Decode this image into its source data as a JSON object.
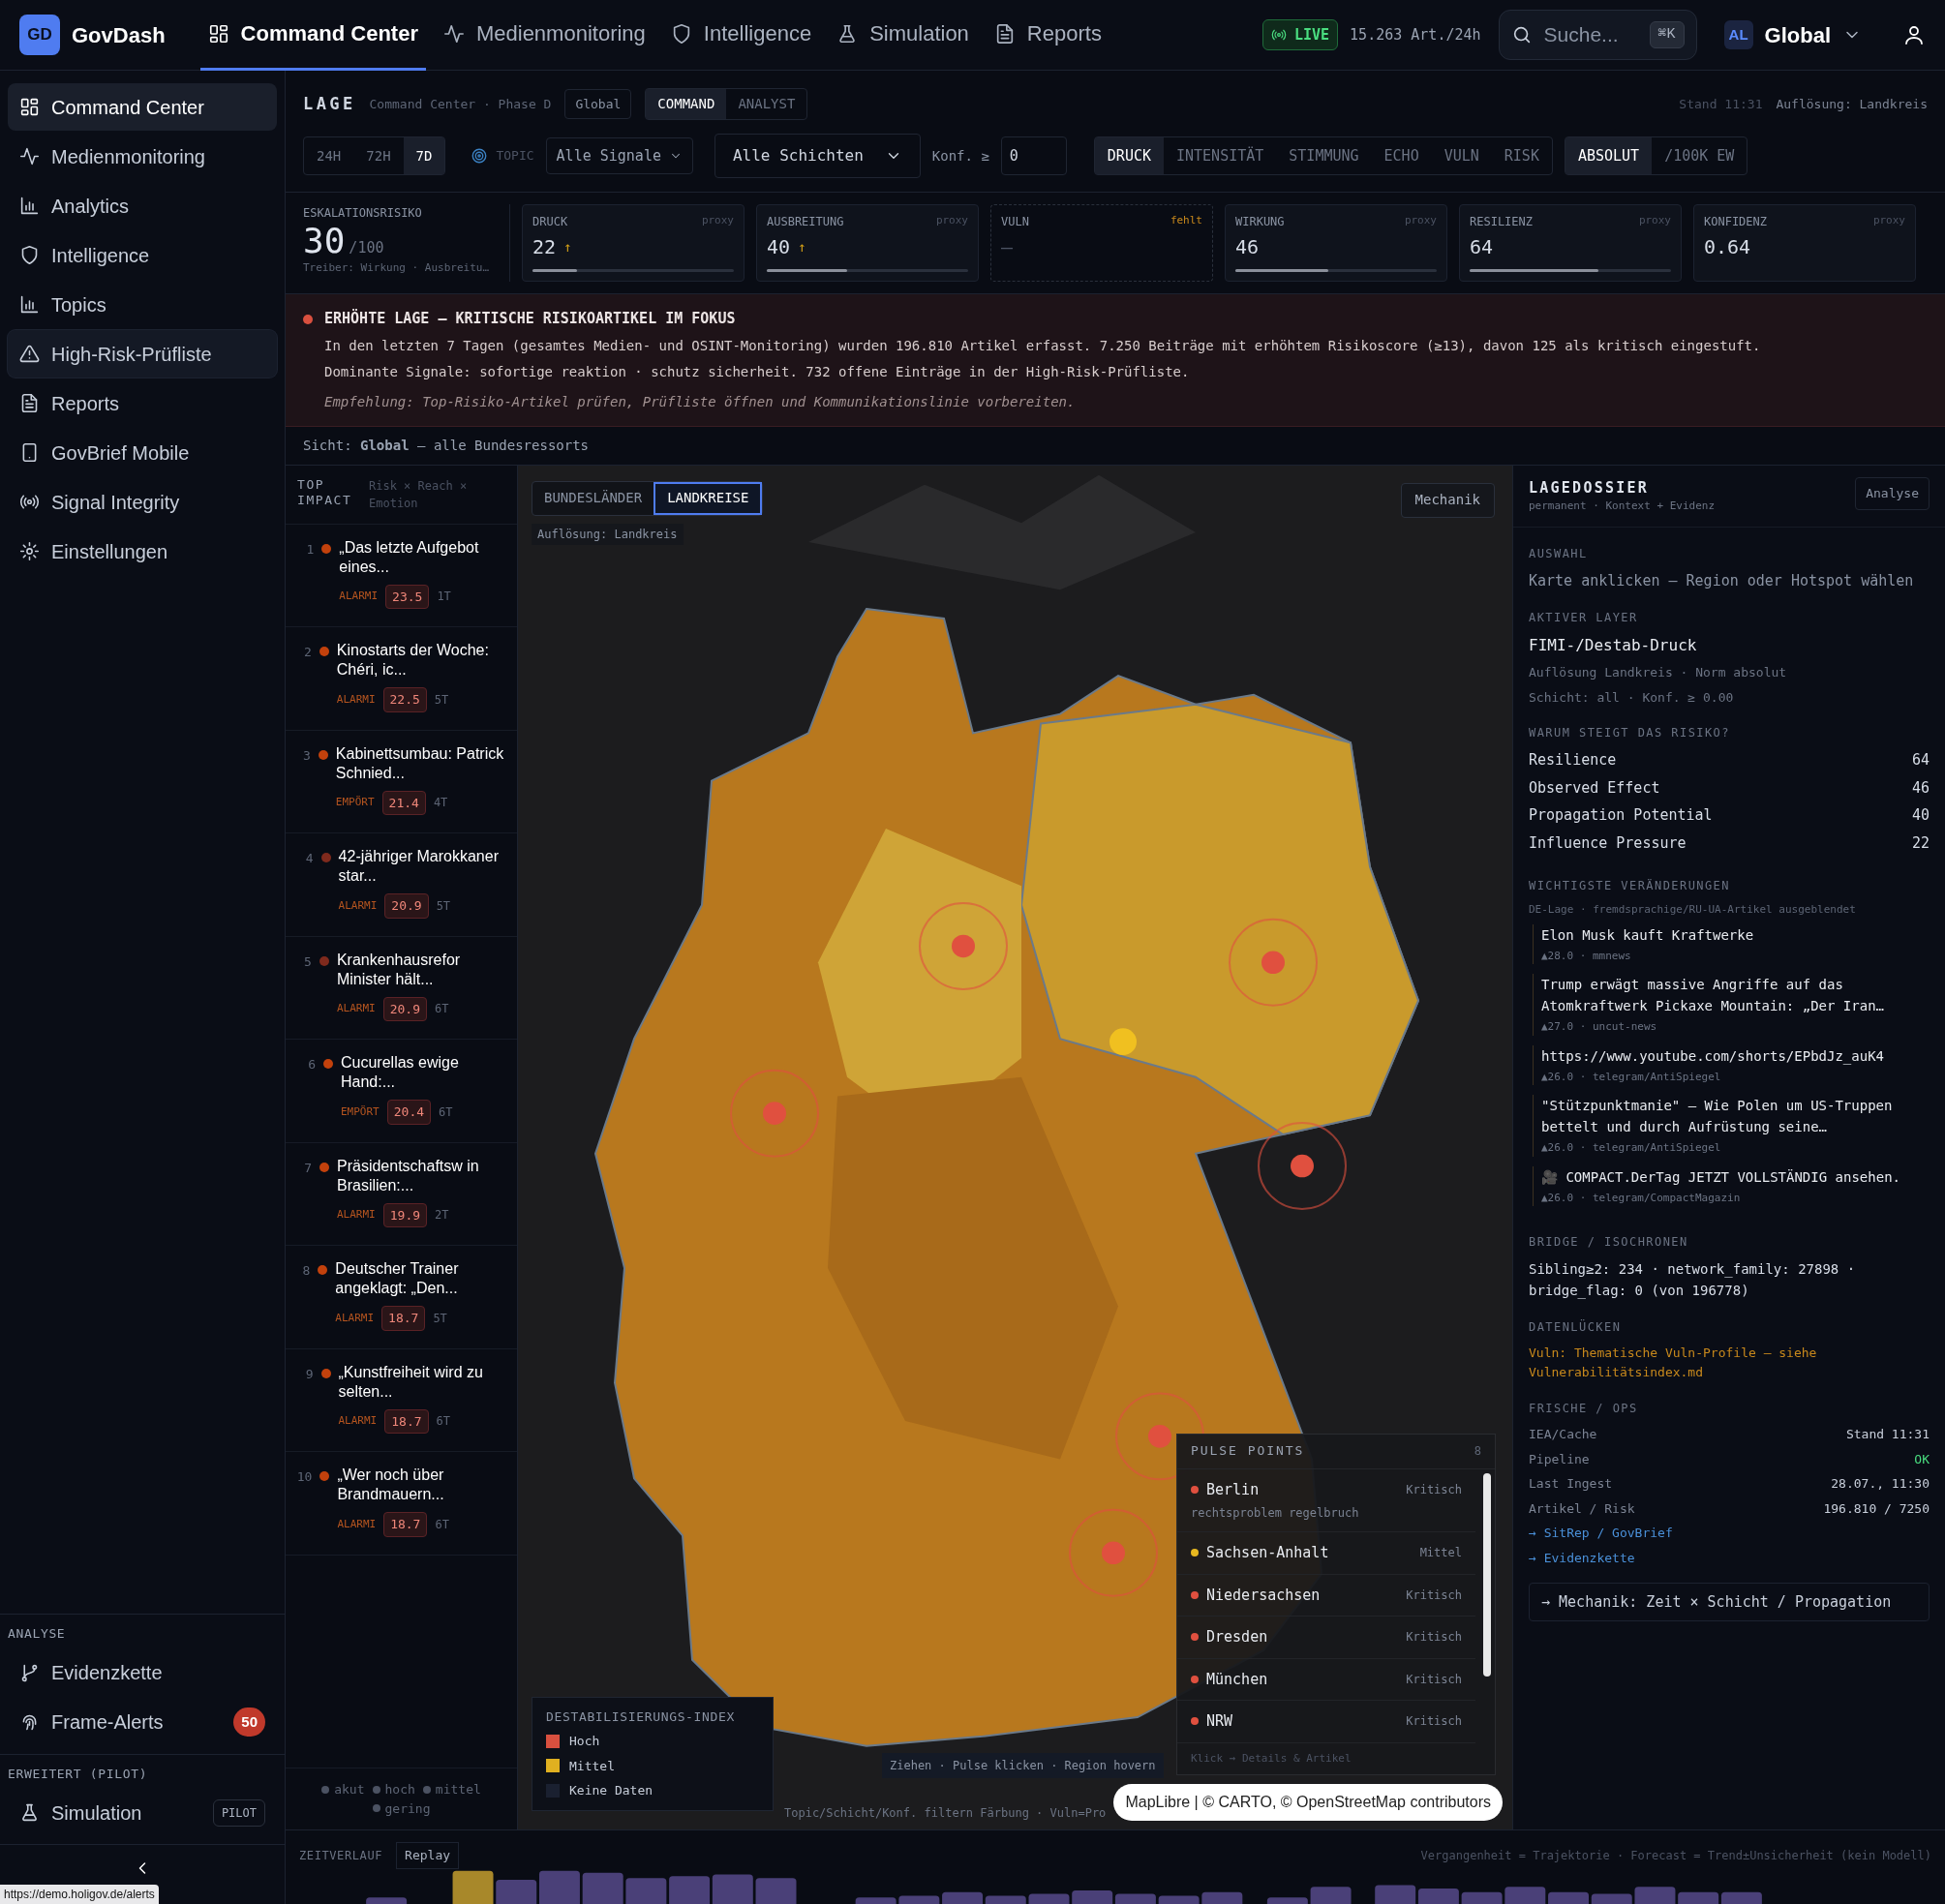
{
  "app": {
    "logo": "GD",
    "name": "GovDash"
  },
  "top_nav": [
    {
      "label": "Command Center",
      "kind": "grid",
      "selected": true
    },
    {
      "label": "Medienmonitoring",
      "kind": "pulse",
      "selected": false
    },
    {
      "label": "Intelligence",
      "kind": "shield",
      "selected": false
    },
    {
      "label": "Simulation",
      "kind": "flask",
      "selected": false
    },
    {
      "label": "Reports",
      "kind": "doc",
      "selected": false
    }
  ],
  "live": {
    "label": "LIVE",
    "rate": "15.263 Art./24h"
  },
  "search": {
    "placeholder": "Suche...",
    "shortcut": "⌘K"
  },
  "scope": {
    "badge": "AL",
    "label": "Global"
  },
  "sidebar": {
    "items": [
      {
        "label": "Command Center",
        "kind": "grid",
        "selected": true,
        "hovered": false
      },
      {
        "label": "Medienmonitoring",
        "kind": "pulse",
        "selected": false,
        "hovered": false
      },
      {
        "label": "Analytics",
        "kind": "bars",
        "selected": false,
        "hovered": false
      },
      {
        "label": "Intelligence",
        "kind": "shield",
        "selected": false,
        "hovered": false
      },
      {
        "label": "Topics",
        "kind": "bars",
        "selected": false,
        "hovered": false
      },
      {
        "label": "High-Risk-Prüfliste",
        "kind": "warning",
        "selected": false,
        "hovered": true
      },
      {
        "label": "Reports",
        "kind": "doc",
        "selected": false,
        "hovered": false
      },
      {
        "label": "GovBrief Mobile",
        "kind": "phone",
        "selected": false,
        "hovered": false
      },
      {
        "label": "Signal Integrity",
        "kind": "signal",
        "selected": false,
        "hovered": false
      },
      {
        "label": "Einstellungen",
        "kind": "gear",
        "selected": false,
        "hovered": false
      }
    ],
    "sections": [
      {
        "title": "ANALYSE",
        "items": [
          {
            "label": "Evidenzkette",
            "kind": "branch"
          },
          {
            "label": "Frame-Alerts",
            "kind": "fingerprint",
            "badge": "50"
          }
        ]
      },
      {
        "title": "ERWEITERT (PILOT)",
        "items": [
          {
            "label": "Simulation",
            "kind": "flask",
            "tag": "PILOT"
          }
        ]
      }
    ]
  },
  "status_url": "https://demo.holigov.de/alerts",
  "lage": {
    "title": "LAGE",
    "subtitle": "Command Center · Phase D",
    "scope": "Global",
    "modes": [
      {
        "label": "COMMAND",
        "selected": true
      },
      {
        "label": "ANALYST",
        "selected": false
      }
    ],
    "stand": "Stand 11:31",
    "resolution": "Auflösung: Landkreis",
    "ranges": [
      {
        "label": "24H",
        "selected": false
      },
      {
        "label": "72H",
        "selected": false
      },
      {
        "label": "7D",
        "selected": true
      }
    ],
    "topic_label": "TOPIC",
    "topic_select": "Alle Signale",
    "layer_select": "Alle Schichten",
    "conf_label": "Konf. ≥",
    "conf_value": "0",
    "metrics": [
      {
        "label": "DRUCK",
        "selected": true
      },
      {
        "label": "INTENSITÄT",
        "selected": false
      },
      {
        "label": "STIMMUNG",
        "selected": false
      },
      {
        "label": "ECHO",
        "selected": false
      },
      {
        "label": "VULN",
        "selected": false
      },
      {
        "label": "RISK",
        "selected": false
      }
    ],
    "norms": [
      {
        "label": "ABSOLUT",
        "selected": true
      },
      {
        "label": "/100K EW",
        "selected": false
      }
    ]
  },
  "escalation": {
    "label": "ESKALATIONSRISIKO",
    "value": "30",
    "max": "/100",
    "drivers": "Treiber: Wirkung · Ausbreitu…"
  },
  "kpis": [
    {
      "kind": "meter",
      "label": "DRUCK",
      "tag": "proxy",
      "value": "22",
      "trend": "↑",
      "level": 0.22
    },
    {
      "kind": "meter",
      "label": "AUSBREITUNG",
      "tag": "proxy",
      "value": "40",
      "trend": "↑",
      "level": 0.4
    },
    {
      "kind": "missing",
      "label": "VULN",
      "tag": "fehlt",
      "value": "—"
    },
    {
      "kind": "meter",
      "label": "WIRKUNG",
      "tag": "proxy",
      "value": "46",
      "level": 0.46
    },
    {
      "kind": "meter",
      "label": "RESILIENZ",
      "tag": "proxy",
      "value": "64",
      "level": 0.64
    },
    {
      "kind": "plain",
      "label": "KONFIDENZ",
      "tag": "proxy",
      "value": "0.64"
    }
  ],
  "alert": {
    "title": "ERHÖHTE LAGE — KRITISCHE RISIKOARTIKEL IM FOKUS",
    "lines": [
      "In den letzten 7 Tagen (gesamtes Medien- und OSINT-Monitoring) wurden 196.810 Artikel erfasst. 7.250 Beiträge mit erhöhtem Risikoscore (≥13), davon 125 als kritisch eingestuft.",
      "Dominante Signale: sofortige reaktion · schutz sicherheit. 732 offene Einträge in der High-Risk-Prüfliste."
    ],
    "recommendation": "Empfehlung: Top-Risiko-Artikel prüfen, Prüfliste öffnen und Kommunikationslinie vorbereiten."
  },
  "view": "Sicht: **Global** — alle Bundesressorts",
  "top_impact": {
    "title": "TOP IMPACT",
    "subtitle": "Risk × Reach × Emotion",
    "items": [
      {
        "rank": "1",
        "title": "„Das letzte Aufgebot eines...",
        "emotion": "ALARMI",
        "score": "23.5",
        "age": "1T",
        "color": "#c2410c"
      },
      {
        "rank": "2",
        "title": "Kinostarts der Woche: Chéri, ic...",
        "emotion": "ALARMI",
        "score": "22.5",
        "age": "5T",
        "color": "#c2410c"
      },
      {
        "rank": "3",
        "title": "Kabinettsumbau: Patrick Schnied...",
        "emotion": "EMPÖRT",
        "score": "21.4",
        "age": "4T",
        "color": "#c2410c"
      },
      {
        "rank": "4",
        "title": "42-jähriger Marokkaner star...",
        "emotion": "ALARMI",
        "score": "20.9",
        "age": "5T",
        "color": "#7f2a1d"
      },
      {
        "rank": "5",
        "title": "Krankenhausrefor Minister hält...",
        "emotion": "ALARMI",
        "score": "20.9",
        "age": "6T",
        "color": "#7f2a1d"
      },
      {
        "rank": "6",
        "title": "Cucurellas ewige Hand:...",
        "emotion": "EMPÖRT",
        "score": "20.4",
        "age": "6T",
        "color": "#c2410c"
      },
      {
        "rank": "7",
        "title": "Präsidentschaftsw in Brasilien:...",
        "emotion": "ALARMI",
        "score": "19.9",
        "age": "2T",
        "color": "#c2410c"
      },
      {
        "rank": "8",
        "title": "Deutscher Trainer angeklagt: „Den...",
        "emotion": "ALARMI",
        "score": "18.7",
        "age": "5T",
        "color": "#c2410c"
      },
      {
        "rank": "9",
        "title": "„Kunstfreiheit wird zu selten...",
        "emotion": "ALARMI",
        "score": "18.7",
        "age": "6T",
        "color": "#c2410c"
      },
      {
        "rank": "10",
        "title": "„Wer noch über Brandmauern...",
        "emotion": "ALARMI",
        "score": "18.7",
        "age": "6T",
        "color": "#c2410c"
      }
    ],
    "legend": [
      {
        "label": "akut",
        "color": "#4b5262"
      },
      {
        "label": "hoch",
        "color": "#4b5262"
      },
      {
        "label": "mittel",
        "color": "#4b5262"
      },
      {
        "label": "gering",
        "color": "#4b5262"
      }
    ]
  },
  "map": {
    "tabs": [
      {
        "label": "BUNDESLÄNDER",
        "selected": false
      },
      {
        "label": "LANDKREISE",
        "selected": true
      }
    ],
    "resolution": "Auflösung: Landkreis",
    "mechanik": "Mechanik",
    "hint": "Ziehen · Pulse klicken · Region hovern",
    "footer": "Topic/Schicht/Konf. filtern Färbung · Vuln=Pro",
    "legend": {
      "title": "DESTABILISIERUNGS-INDEX",
      "items": [
        {
          "label": "Hoch",
          "color": "#d9503f"
        },
        {
          "label": "Mittel",
          "color": "#e0b020"
        },
        {
          "label": "Keine Daten",
          "color": "#1a2030"
        }
      ]
    },
    "pulse_points": {
      "title": "PULSE POINTS",
      "count": "8",
      "items": [
        {
          "name": "Berlin",
          "severity": "Kritisch",
          "tags": "rechtsproblem regelbruch",
          "color": "#e0503f"
        },
        {
          "name": "Sachsen-Anhalt",
          "severity": "Mittel",
          "color": "#e8b820"
        },
        {
          "name": "Niedersachsen",
          "severity": "Kritisch",
          "color": "#e0503f"
        },
        {
          "name": "Dresden",
          "severity": "Kritisch",
          "color": "#e0503f"
        },
        {
          "name": "München",
          "severity": "Kritisch",
          "color": "#e0503f"
        },
        {
          "name": "NRW",
          "severity": "Kritisch",
          "color": "#e0503f"
        }
      ],
      "footer": "Klick → Details & Artikel"
    },
    "attribution": "MapLibre | © CARTO, © OpenStreetMap contributors"
  },
  "dossier": {
    "title": "LAGEDOSSIER",
    "subtitle": "permanent · Kontext + Evidenz",
    "button": "Analyse",
    "selection_title": "AUSWAHL",
    "selection_text": "Karte anklicken — Region oder Hotspot wählen",
    "layer_title": "AKTIVER LAYER",
    "layer_name": "FIMI-/Destab-Druck",
    "layer_lines": [
      "Auflösung Landkreis · Norm absolut",
      "Schicht: all · Konf. ≥ 0.00"
    ],
    "why_title": "WARUM STEIGT DAS RISIKO?",
    "why": [
      {
        "label": "Resilience",
        "value": "64"
      },
      {
        "label": "Observed Effect",
        "value": "46"
      },
      {
        "label": "Propagation Potential",
        "value": "40"
      },
      {
        "label": "Influence Pressure",
        "value": "22"
      }
    ],
    "changes_title": "WICHTIGSTE VERÄNDERUNGEN",
    "changes_note": "DE-Lage · fremdsprachige/RU-UA-Artikel ausgeblendet",
    "changes": [
      {
        "title": "Elon Musk kauft Kraftwerke",
        "meta": "▲28.0 · mmnews"
      },
      {
        "title": "Trump erwägt massive Angriffe auf das Atomkraftwerk Pickaxe Mountain: „Der Iran…",
        "meta": "▲27.0 · uncut-news"
      },
      {
        "title": "https://www.youtube.com/shorts/EPbdJz_auK4",
        "meta": "▲26.0 · telegram/AntiSpiegel"
      },
      {
        "title": "\"Stützpunktmanie\" – Wie Polen um US-Truppen bettelt und durch Aufrüstung seine…",
        "meta": "▲26.0 · telegram/AntiSpiegel"
      },
      {
        "title": "🎥 COMPACT.DerTag JETZT VOLLSTÄNDIG ansehen.",
        "meta": "▲26.0 · telegram/CompactMagazin"
      }
    ],
    "bridge_title": "BRIDGE / ISOCHRONEN",
    "bridge_text": "Sibling≥2: 234 · network_family: 27898 · bridge_flag: 0 (von 196778)",
    "gaps_title": "DATENLÜCKEN",
    "gaps_text": "Vuln: Thematische Vuln-Profile — siehe Vulnerabilitätsindex.md",
    "ops_title": "FRISCHE / OPS",
    "ops": [
      {
        "label": "IEA/Cache",
        "value": "Stand 11:31",
        "ok": false
      },
      {
        "label": "Pipeline",
        "value": "OK",
        "ok": true
      },
      {
        "label": "Last Ingest",
        "value": "28.07., 11:30",
        "ok": false
      },
      {
        "label": "Artikel / Risk",
        "value": "196.810 / 7250",
        "ok": false
      }
    ],
    "links": [
      "→ SitRep / GovBrief",
      "→ Evidenzkette"
    ],
    "mechanik_button": "→ Mechanik: Zeit × Schicht / Propagation"
  },
  "timeline": {
    "title": "ZEITVERLAUF",
    "button": "Replay",
    "note": "Vergangenheit = Trajektorie · Forecast = Trend±Unsicherheit (kein Modell)"
  }
}
